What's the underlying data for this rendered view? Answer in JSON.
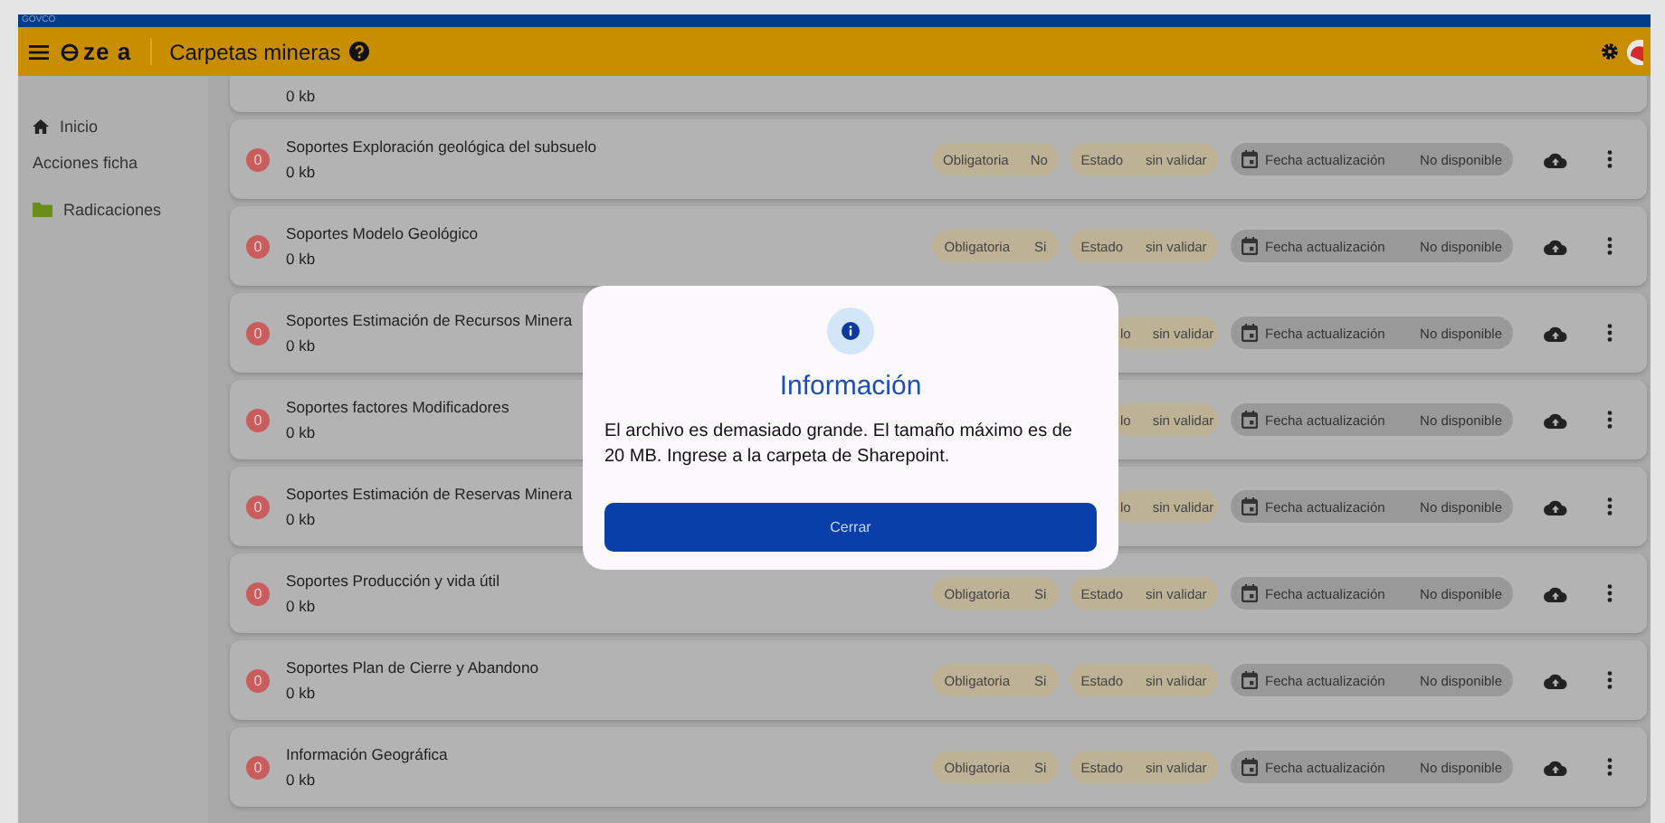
{
  "govbar": {
    "label": "GOVCO"
  },
  "header": {
    "brand": "ze a",
    "title": "Carpetas mineras"
  },
  "sidebar": {
    "items": [
      {
        "label": "Inicio",
        "kind": "home"
      },
      {
        "label": "Acciones ficha",
        "kind": "plain"
      },
      {
        "label": "Radicaciones",
        "kind": "folder"
      }
    ]
  },
  "rows": [
    {
      "kind": "partial",
      "size": "0 kb"
    },
    {
      "kind": "full",
      "badge": "0",
      "title": "Soportes Exploración geológica del subsuelo",
      "size": "0 kb",
      "required_label": "Obligatoria",
      "required": "No",
      "status_label": "Estado",
      "status": "sin validar",
      "date_label": "Fecha actualización",
      "date": "No disponible"
    },
    {
      "kind": "full",
      "badge": "0",
      "title": "Soportes Modelo Geológico",
      "size": "0 kb",
      "required_label": "Obligatoria",
      "required": "Si",
      "status_label": "Estado",
      "status": "sin validar",
      "date_label": "Fecha actualización",
      "date": "No disponible"
    },
    {
      "kind": "covered",
      "badge": "0",
      "title": "Soportes Estimación de Recursos Minera",
      "size": "0 kb",
      "status_label": "lo",
      "status": "sin validar",
      "date_label": "Fecha actualización",
      "date": "No disponible"
    },
    {
      "kind": "covered",
      "badge": "0",
      "title": "Soportes factores Modificadores",
      "size": "0 kb",
      "status_label": "lo",
      "status": "sin validar",
      "date_label": "Fecha actualización",
      "date": "No disponible"
    },
    {
      "kind": "covered",
      "badge": "0",
      "title": "Soportes Estimación de Reservas Minera",
      "size": "0 kb",
      "status_label": "lo",
      "status": "sin validar",
      "date_label": "Fecha actualización",
      "date": "No disponible"
    },
    {
      "kind": "full",
      "badge": "0",
      "title": "Soportes Producción y vida útil",
      "size": "0 kb",
      "required_label": "Obligatoria",
      "required": "Si",
      "status_label": "Estado",
      "status": "sin validar",
      "date_label": "Fecha actualización",
      "date": "No disponible"
    },
    {
      "kind": "full",
      "badge": "0",
      "title": "Soportes Plan de Cierre y Abandono",
      "size": "0 kb",
      "required_label": "Obligatoria",
      "required": "Si",
      "status_label": "Estado",
      "status": "sin validar",
      "date_label": "Fecha actualización",
      "date": "No disponible"
    },
    {
      "kind": "full",
      "badge": "0",
      "title": "Información Geográfica",
      "size": "0 kb",
      "required_label": "Obligatoria",
      "required": "Si",
      "status_label": "Estado",
      "status": "sin validar",
      "date_label": "Fecha actualización",
      "date": "No disponible"
    }
  ],
  "dialog": {
    "title": "Información",
    "message": "El archivo es demasiado grande. El tamaño máximo es de 20 MB. Ingrese a la carpeta de Sharepoint.",
    "button": "Cerrar"
  }
}
